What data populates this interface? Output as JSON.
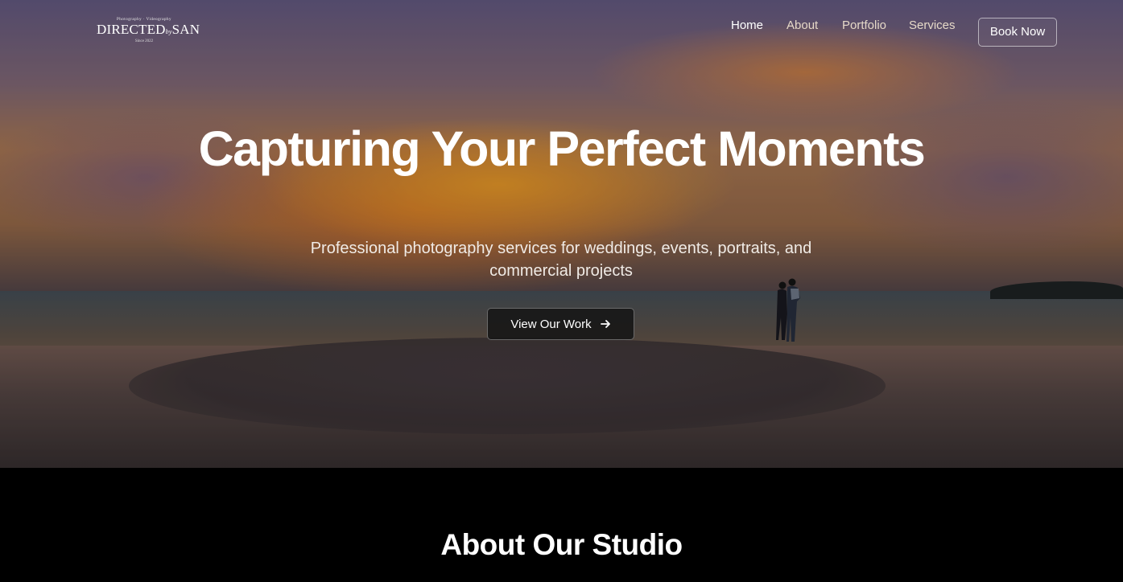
{
  "brand": {
    "tagline": "Photography · Videography",
    "name_left": "DIRECTED",
    "name_joiner": "by",
    "name_right": "SAN",
    "since": "Since 2022"
  },
  "nav": {
    "items": [
      {
        "label": "Home",
        "active": true
      },
      {
        "label": "About",
        "active": false
      },
      {
        "label": "Portfolio",
        "active": false
      },
      {
        "label": "Services",
        "active": false
      }
    ],
    "cta_label": "Book Now"
  },
  "hero": {
    "title": "Capturing Your Perfect Moments",
    "subtitle": "Professional photography services for weddings, events, portraits, and commercial projects",
    "button_label": "View Our Work",
    "button_icon": "arrow-right-icon"
  },
  "about": {
    "title": "About Our Studio"
  },
  "colors": {
    "page_bg": "#000000",
    "nav_text": "#e6d9c8",
    "nav_active": "#ffffff",
    "button_bg": "#161616"
  }
}
